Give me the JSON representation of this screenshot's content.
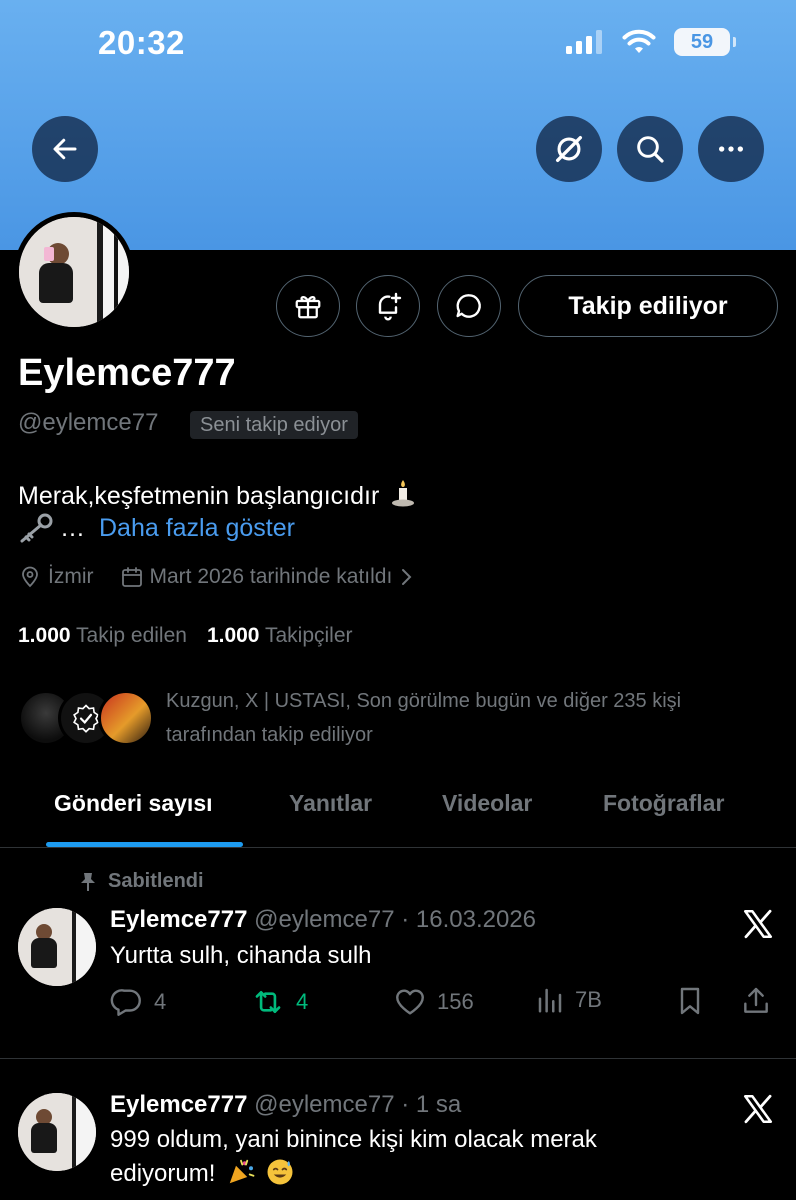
{
  "status_bar": {
    "time": "20:32",
    "battery": "59"
  },
  "profile": {
    "display_name": "Eylemce777",
    "handle": "@eylemce77",
    "follows_you": "Seni takip ediyor",
    "follow_button": "Takip ediliyor",
    "bio_line1": "Merak,keşfetmenin başlangıcıdır",
    "bio_line2": "…",
    "show_more": "Daha fazla göster",
    "location": "İzmir",
    "joined": "Mart 2026 tarihinde katıldı",
    "following_count": "1.000",
    "following_label": "Takip edilen",
    "followers_count": "1.000",
    "followers_label": "Takipçiler",
    "mutuals_line1": "Kuzgun, X | USTASI, Son görülme bugün ve diğer 235 kişi",
    "mutuals_line2": "tarafından takip ediliyor"
  },
  "tabs": [
    {
      "label": "Gönderi sayısı",
      "active": true
    },
    {
      "label": "Yanıtlar"
    },
    {
      "label": "Videolar"
    },
    {
      "label": "Fotoğraflar"
    }
  ],
  "posts": [
    {
      "pinned_label": "Sabitlendi",
      "name": "Eylemce777",
      "handle": "@eylemce77",
      "time": "· 16.03.2026",
      "text": "Yurtta sulh, cihanda sulh",
      "replies": "4",
      "reposts": "4",
      "likes": "156",
      "views": "7B"
    },
    {
      "name": "Eylemce777",
      "handle": "@eylemce77",
      "time": "· 1 sa",
      "text_line1": "999 oldum, yani binince kişi kim olacak merak",
      "text_line2": "ediyorum!"
    }
  ],
  "colors": {
    "accent": "#1d9bf0",
    "link": "#4a9cef",
    "repost": "#00ba7c",
    "banner": "#4a96e4"
  }
}
